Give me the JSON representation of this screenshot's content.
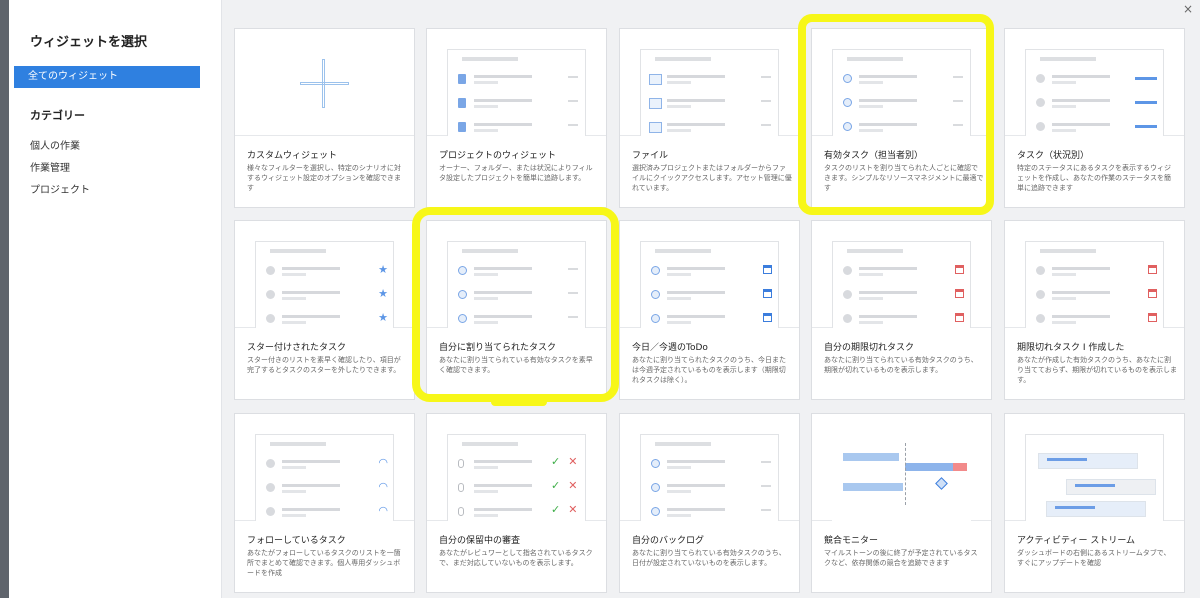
{
  "close_icon": "×",
  "sidebar": {
    "title": "ウィジェットを選択",
    "all_label": "全てのウィジェット",
    "category_label": "カテゴリー",
    "items": [
      {
        "label": "個人の作業"
      },
      {
        "label": "作業管理"
      },
      {
        "label": "プロジェクト"
      }
    ]
  },
  "accent_color": "#2f80e0",
  "highlight_color": "#f7f718",
  "widgets": [
    {
      "title": "カスタムウィジェット",
      "desc": "様々なフィルターを選択し、特定のシナリオに対するウィジェット設定のオプションを確認できます",
      "preview": "plus"
    },
    {
      "title": "プロジェクトのウィジェット",
      "desc": "オーナー、フォルダー、または状況によりフィルタ設定したプロジェクトを簡単に追跡します。",
      "preview": "doc-list"
    },
    {
      "title": "ファイル",
      "desc": "選択済みプロジェクトまたはフォルダーからファイルにクイックアクセスします。アセット管理に優れています。",
      "preview": "image-list"
    },
    {
      "title": "有効タスク（担当者別）",
      "desc": "タスクのリストを割り当てられた人ごとに確認できます。シンプルなリソースマネジメントに最適です",
      "preview": "avatar-list"
    },
    {
      "title": "タスク（状況別）",
      "desc": "特定のステータスにあるタスクを表示するウィジェットを作成し、あなたの作業のステータスを簡単に追跡できます",
      "preview": "status-list"
    },
    {
      "title": "スター付けされたタスク",
      "desc": "スター付きのリストを素早く確認したり、項目が完了するとタスクのスターを外したりできます。",
      "preview": "star-list"
    },
    {
      "title": "自分に割り当てられたタスク",
      "desc": "あなたに割り当てられている有効なタスクを素早く確認できます。",
      "preview": "avatar-list"
    },
    {
      "title": "今日／今週のToDo",
      "desc": "あなたに割り当てられたタスクのうち、今日または今週予定されているものを表示します（期限切れタスクは除く）。",
      "preview": "calendar-blue"
    },
    {
      "title": "自分の期限切れタスク",
      "desc": "あなたに割り当てられている有効タスクのうち、期限が切れているものを表示します。",
      "preview": "calendar-red"
    },
    {
      "title": "期限切れタスク I 作成した",
      "desc": "あなたが作成した有効タスクのうち、あなたに割り当てておらず、期限が切れているものを表示します。",
      "preview": "calendar-red"
    },
    {
      "title": "フォローしているタスク",
      "desc": "あなたがフォローしているタスクのリストを一箇所でまとめて確認できます。個人専用ダッシュボードを作成",
      "preview": "rss-list"
    },
    {
      "title": "自分の保留中の審査",
      "desc": "あなたがレビュワーとして指名されているタスクで、まだ対応していないものを表示します。",
      "preview": "review-list"
    },
    {
      "title": "自分のバックログ",
      "desc": "あなたに割り当てられている有効タスクのうち、日付が設定されていないものを表示します。",
      "preview": "avatar-dash"
    },
    {
      "title": "競合モニター",
      "desc": "マイルストーンの後に終了が予定されているタスクなど、依存関係の競合を追跡できます",
      "preview": "gantt"
    },
    {
      "title": "アクティビティー ストリーム",
      "desc": "ダッシュボードの右側にあるストリームタブで、すぐにアップデートを確認",
      "preview": "stream"
    }
  ]
}
